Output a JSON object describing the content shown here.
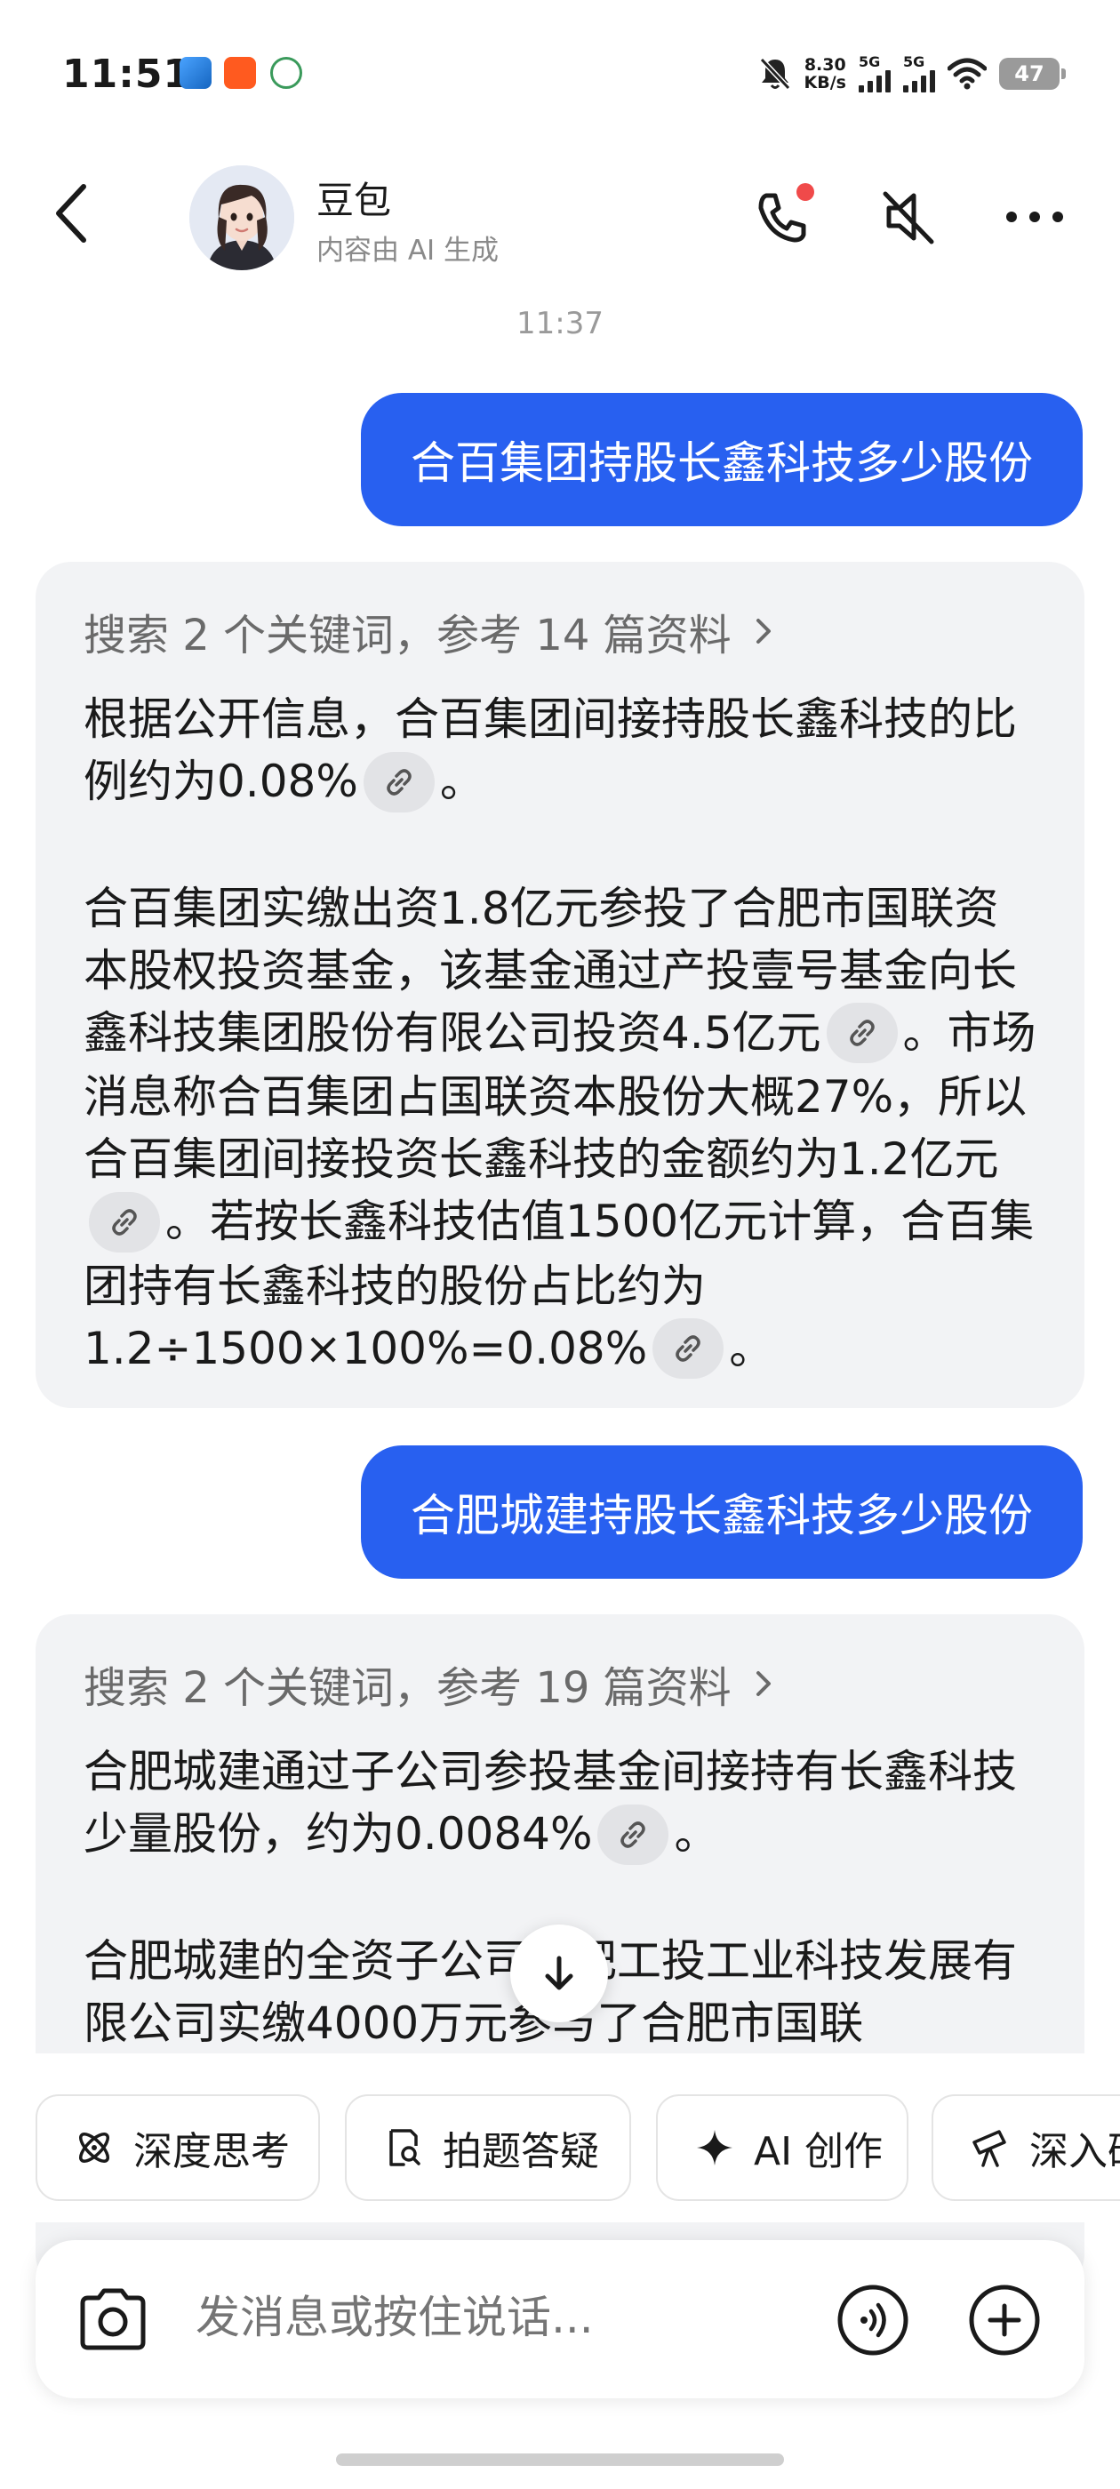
{
  "status_bar": {
    "time": "11:51",
    "net_speed_value": "8.30",
    "net_speed_unit": "KB/s",
    "signal1_label": "5G",
    "signal2_label": "5G",
    "battery": "47"
  },
  "header": {
    "name": "豆包",
    "subtitle": "内容由 AI 生成",
    "icons": [
      "back-arrow-icon",
      "phone-icon",
      "mute-icon",
      "more-icon"
    ]
  },
  "timestamp": "11:37",
  "messages": [
    {
      "role": "user",
      "text": "合百集团持股长鑫科技多少股份"
    },
    {
      "role": "ai",
      "search": "搜索 2 个关键词，参考 14 篇资料",
      "paragraphs": [
        {
          "t1": "根据公开信息，合百集团间接持股长鑫科技的比例约为0.08%",
          "t2": "。"
        },
        {
          "t1": "合百集团实缴出资1.8亿元参投了合肥市国联资本股权投资基金，该基金通过产投壹号基金向长鑫科技集团股份有限公司投资4.5亿元",
          "t2": "。市场消息称合百集团占国联资本股份大概27%，所以合百集团间接投资长鑫科技的金额约为1.2亿元",
          "t3": "。若按长鑫科技估值1500亿元计算，合百集团持有长鑫科技的股份占比约为1.2÷1500×100%=0.08%",
          "t4": "。"
        }
      ]
    },
    {
      "role": "user",
      "text": "合肥城建持股长鑫科技多少股份"
    },
    {
      "role": "ai",
      "search": "搜索 2 个关键词，参考 19 篇资料",
      "paragraphs": [
        {
          "t1": "合肥城建通过子公司参投基金间接持有长鑫科技少量股份，约为0.0084%",
          "t2": "。"
        },
        {
          "t1": "合肥城建的全资子公司合肥工投工业科技发展有限公司实缴4000万元参与了合肥市国联"
        }
      ]
    }
  ],
  "chips": [
    "深度思考",
    "拍题答疑",
    "AI 创作",
    "深入研究"
  ],
  "input": {
    "placeholder": "发消息或按住说话..."
  },
  "colors": {
    "accent": "#2860f0",
    "card_bg": "#f2f3f5",
    "notification_dot": "#f04a4a"
  }
}
